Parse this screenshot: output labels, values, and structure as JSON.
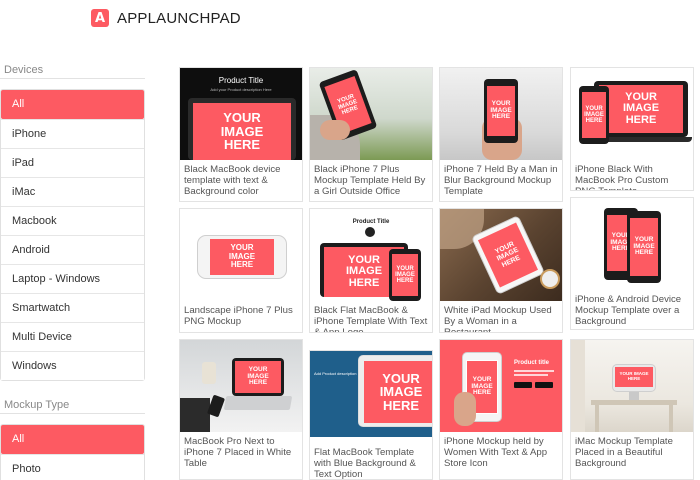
{
  "brand": {
    "logo_letter": "A",
    "name": "APPLAUNCHPAD",
    "accent": "#fd5a62"
  },
  "sidebar": {
    "devices": {
      "title": "Devices",
      "items": [
        "All",
        "iPhone",
        "iPad",
        "iMac",
        "Macbook",
        "Android",
        "Laptop - Windows",
        "Smartwatch",
        "Multi Device",
        "Windows"
      ]
    },
    "mockup_type": {
      "title": "Mockup Type",
      "items": [
        "All",
        "Photo"
      ]
    }
  },
  "placeholder": "YOUR IMAGE HERE",
  "cards": [
    {
      "caption": "Black MacBook device template with text & Background color",
      "product_title": "Product Title",
      "product_desc": "Add your Product description Here"
    },
    {
      "caption": "Black iPhone 7 Plus Mockup Template Held By a Girl Outside Office"
    },
    {
      "caption": "iPhone 7 Held By a Man in Blur Background Mockup Template"
    },
    {
      "caption": "iPhone Black With MacBook Pro Custom PNG Template"
    },
    {
      "caption": "Landscape iPhone 7 Plus PNG Mockup"
    },
    {
      "caption": "Black Flat MacBook & iPhone Template With Text & App Logo",
      "product_title": "Product Title"
    },
    {
      "caption": "White iPad Mockup Used By a Woman in a Restaurant"
    },
    {
      "caption": "iPhone & Android Device Mockup Template over a Background"
    },
    {
      "caption": "MacBook Pro Next to iPhone 7 Placed in White Table"
    },
    {
      "caption": "Flat MacBook Template with Blue Background & Text Option",
      "product_desc": "Add Product description"
    },
    {
      "caption": "iPhone Mockup held by Women With Text & App Store Icon",
      "product_title": "Product title"
    },
    {
      "caption": "iMac Mockup Template Placed in a Beautiful Background"
    }
  ]
}
